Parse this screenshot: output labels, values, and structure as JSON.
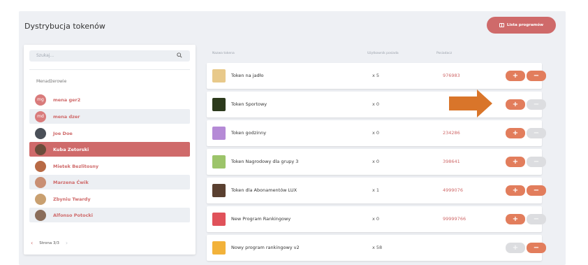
{
  "page": {
    "title": "Dystrybucja tokenów",
    "list_button": "Lista programów"
  },
  "search": {
    "placeholder": "Szukaj..."
  },
  "managers": {
    "title": "Menadżerowie",
    "items": [
      {
        "name": "mena ger2",
        "initials": "mg",
        "avatar_color": "#d97b7b",
        "style": "plain"
      },
      {
        "name": "mena dzer",
        "initials": "md",
        "avatar_color": "#d97b7b",
        "style": "grey"
      },
      {
        "name": "Joe Doe",
        "initials": "",
        "avatar_color": "#4a5058",
        "style": "plain"
      },
      {
        "name": "Kuba Zetorski",
        "initials": "",
        "avatar_color": "#6b4c3b",
        "style": "selected"
      },
      {
        "name": "Mietek Bezlitosny",
        "initials": "",
        "avatar_color": "#b86a45",
        "style": "plain"
      },
      {
        "name": "Marzena Ćwik",
        "initials": "",
        "avatar_color": "#c98f73",
        "style": "grey"
      },
      {
        "name": "Zbyniu Twardy",
        "initials": "",
        "avatar_color": "#c9a070",
        "style": "plain"
      },
      {
        "name": "Alfonso Potocki",
        "initials": "",
        "avatar_color": "#8a6d5a",
        "style": "grey"
      }
    ]
  },
  "pager": {
    "label": "Strona 3/3"
  },
  "columns": {
    "name": "Nazwa tokena",
    "users": "Użytkownik posiada",
    "owners": "Posiadacz"
  },
  "tokens": [
    {
      "name": "Token na jadło",
      "users": "x 5",
      "owners": "976983",
      "icon": "food-icon",
      "color": "#e8c98a",
      "plus": true,
      "minus": true
    },
    {
      "name": "Token Sportowy",
      "users": "x 0",
      "owners": "",
      "icon": "sport-icon",
      "color": "#2c3a1c",
      "plus": true,
      "minus": false
    },
    {
      "name": "Token godzinny",
      "users": "x 0",
      "owners": "234286",
      "icon": "brain-icon",
      "color": "#b58ad6",
      "plus": true,
      "minus": false
    },
    {
      "name": "Token Nagrodowy dla grupy 3",
      "users": "x 0",
      "owners": "398641",
      "icon": "globe-icon",
      "color": "#9cc46a",
      "plus": true,
      "minus": false
    },
    {
      "name": "Token dla Abonamentów LUX",
      "users": "x 1",
      "owners": "4999076",
      "icon": "lux-icon",
      "color": "#5a4030",
      "plus": true,
      "minus": true
    },
    {
      "name": "New Program Rankingowy",
      "users": "x 0",
      "owners": "99999766",
      "icon": "airbnb-icon",
      "color": "#e0525a",
      "plus": true,
      "minus": false
    },
    {
      "name": "Nowy program rankingowy v2",
      "users": "x 58",
      "owners": "",
      "icon": "pizza-icon",
      "color": "#f2b23a",
      "plus": false,
      "minus": true
    }
  ],
  "colors": {
    "accent": "#cf6a6a",
    "button": "#e27d5c",
    "disabled": "#dcdde0",
    "arrow": "#d9752a"
  }
}
